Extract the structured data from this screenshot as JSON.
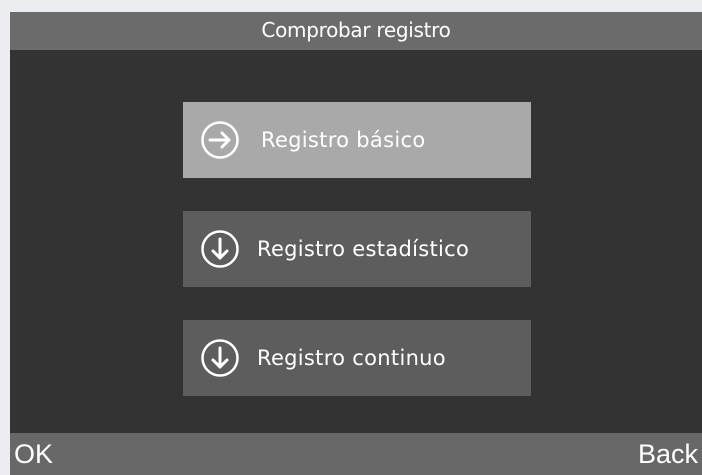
{
  "screen": {
    "title": "Comprobar registro"
  },
  "menu": {
    "items": [
      {
        "label": "Registro básico",
        "icon": "arrow-right-circle-icon",
        "selected": true
      },
      {
        "label": "Registro estadístico",
        "icon": "arrow-down-circle-icon",
        "selected": false
      },
      {
        "label": "Registro continuo",
        "icon": "arrow-down-circle-icon",
        "selected": false
      }
    ]
  },
  "softkeys": {
    "left_label": "OK",
    "right_label": "Back"
  },
  "colors": {
    "screen_background": "#333333",
    "title_bar": "#6b6b6b",
    "item_background": "#5d5d5d",
    "item_selected": "#a9a9a9",
    "softkey_bar": "#686868",
    "text": "#ffffff"
  }
}
